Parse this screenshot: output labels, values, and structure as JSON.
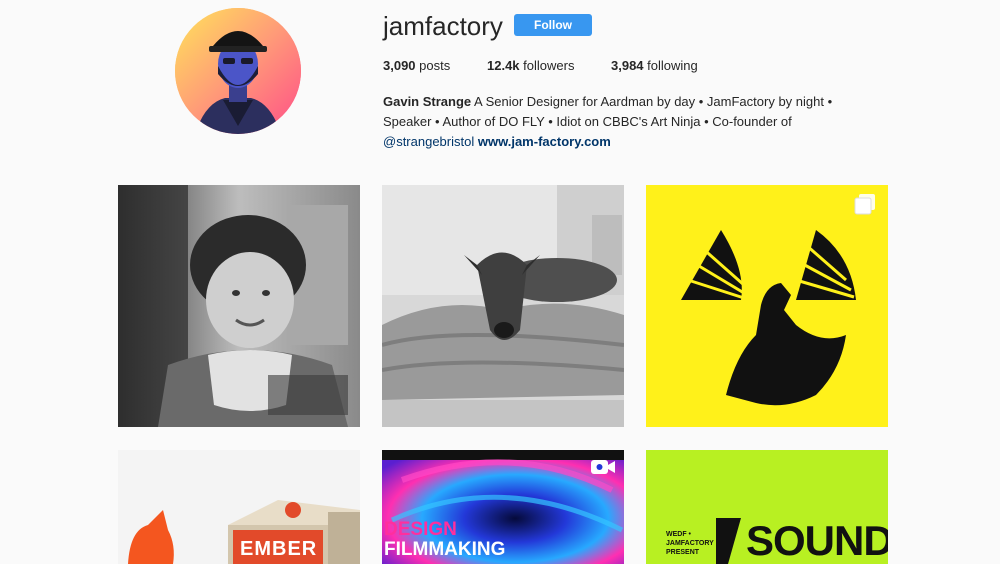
{
  "profile": {
    "username": "jamfactory",
    "follow_label": "Follow",
    "stats": {
      "posts_count": "3,090",
      "posts_label": "posts",
      "followers_count": "12.4k",
      "followers_label": "followers",
      "following_count": "3,984",
      "following_label": "following"
    },
    "bio": {
      "name": "Gavin Strange",
      "text_line1": " A Senior Designer for Aardman by day • JamFactory by night •",
      "text_line2": "Speaker • Author of DO FLY • Idiot on CBBC's Art Ninja • Co-founder of",
      "handle": "@strangebristol",
      "website": "www.jam-factory.com"
    }
  },
  "grid": {
    "posts": [
      {
        "subject": "toddler-photo",
        "type": "photo"
      },
      {
        "subject": "greyhound-dog-photo",
        "type": "photo"
      },
      {
        "subject": "radiation-godzilla-poster",
        "type": "carousel",
        "badge": "carousel-icon"
      },
      {
        "subject": "ember-matchbox-photo",
        "type": "photo",
        "box_text": "EMBER"
      },
      {
        "subject": "design-filmmaking-video",
        "type": "video",
        "badge": "video-icon",
        "text_line1": "DESIGN",
        "text_line2": "FILMMAKING"
      },
      {
        "subject": "sound-event-poster",
        "type": "photo",
        "small_text": "WEDF • JAMFACTORY PRESENT",
        "title": "SOUND"
      }
    ]
  },
  "colors": {
    "follow_button": "#3897f0",
    "link": "#003569",
    "background": "#fafafa",
    "yellow_poster": "#fff11a",
    "green_poster": "#b8f022"
  }
}
